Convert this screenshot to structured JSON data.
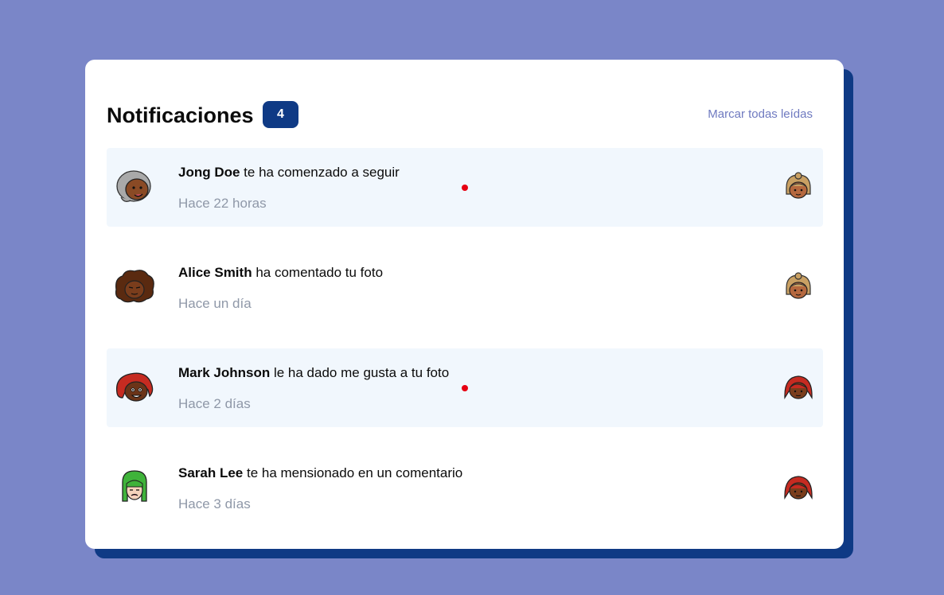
{
  "colors": {
    "page_background": "#7a86c8",
    "card_background": "#ffffff",
    "accent": "#0f3a85",
    "unread_background": "#f1f7fd",
    "unread_dot": "#e60012",
    "muted_text": "#8f98a8",
    "link_text": "#6f7ac0"
  },
  "header": {
    "title": "Notificaciones",
    "count": "4",
    "mark_all_label": "Marcar todas leídas"
  },
  "notifications": [
    {
      "name": "Jong Doe",
      "action": " te ha comenzado a seguir",
      "time": "Hace 22 horas",
      "unread": true,
      "avatar_icon": "gray-hair-avatar-icon",
      "thumb_icon": "blonde-face-thumb-icon"
    },
    {
      "name": "Alice Smith",
      "action": " ha comentado tu foto",
      "time": "Hace un día",
      "unread": false,
      "avatar_icon": "curly-brown-hair-avatar-icon",
      "thumb_icon": "blonde-face-thumb-icon"
    },
    {
      "name": "Mark Johnson",
      "action": " le ha dado me gusta a tu foto",
      "time": "Hace 2 días",
      "unread": true,
      "avatar_icon": "red-hair-avatar-icon",
      "thumb_icon": "red-hair-face-thumb-icon"
    },
    {
      "name": "Sarah Lee",
      "action": " te ha mensionado en un comentario",
      "time": "Hace 3 días",
      "unread": false,
      "avatar_icon": "green-hair-avatar-icon",
      "thumb_icon": "red-hair-face-thumb-icon"
    }
  ]
}
